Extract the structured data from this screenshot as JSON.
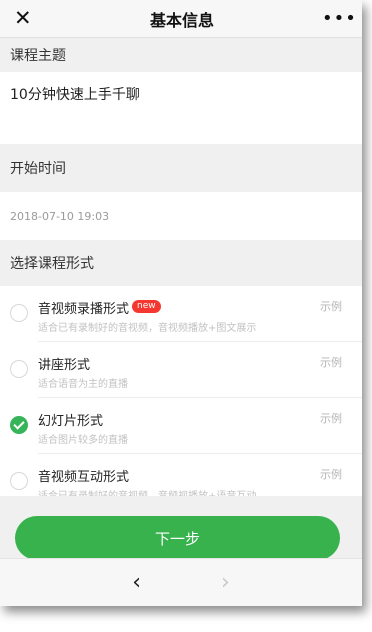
{
  "header": {
    "close_icon": "✕",
    "title": "基本信息",
    "more_icon": "•••"
  },
  "topic": {
    "label": "课程主题",
    "value": "10分钟快速上手千聊"
  },
  "start_time": {
    "label": "开始时间",
    "value": "2018-07-10 19:03"
  },
  "format": {
    "label": "选择课程形式",
    "options": [
      {
        "title": "音视频录播形式",
        "badge": "new",
        "desc": "适合已有录制好的音视频，音视频播放+图文展示",
        "example": "示例",
        "selected": false
      },
      {
        "title": "讲座形式",
        "badge": "",
        "desc": "适合语音为主的直播",
        "example": "示例",
        "selected": false
      },
      {
        "title": "幻灯片形式",
        "badge": "",
        "desc": "适合图片较多的直播",
        "example": "示例",
        "selected": true
      },
      {
        "title": "音视频互动形式",
        "badge": "",
        "desc": "适合已有录制好的音视频，音频视播放+语音互动",
        "example": "示例",
        "selected": false
      }
    ]
  },
  "actions": {
    "next_label": "下一步"
  },
  "nav": {
    "back_icon": "‹",
    "forward_icon": "›"
  },
  "colors": {
    "accent_green": "#37b24d",
    "badge_red": "#f5382f"
  }
}
